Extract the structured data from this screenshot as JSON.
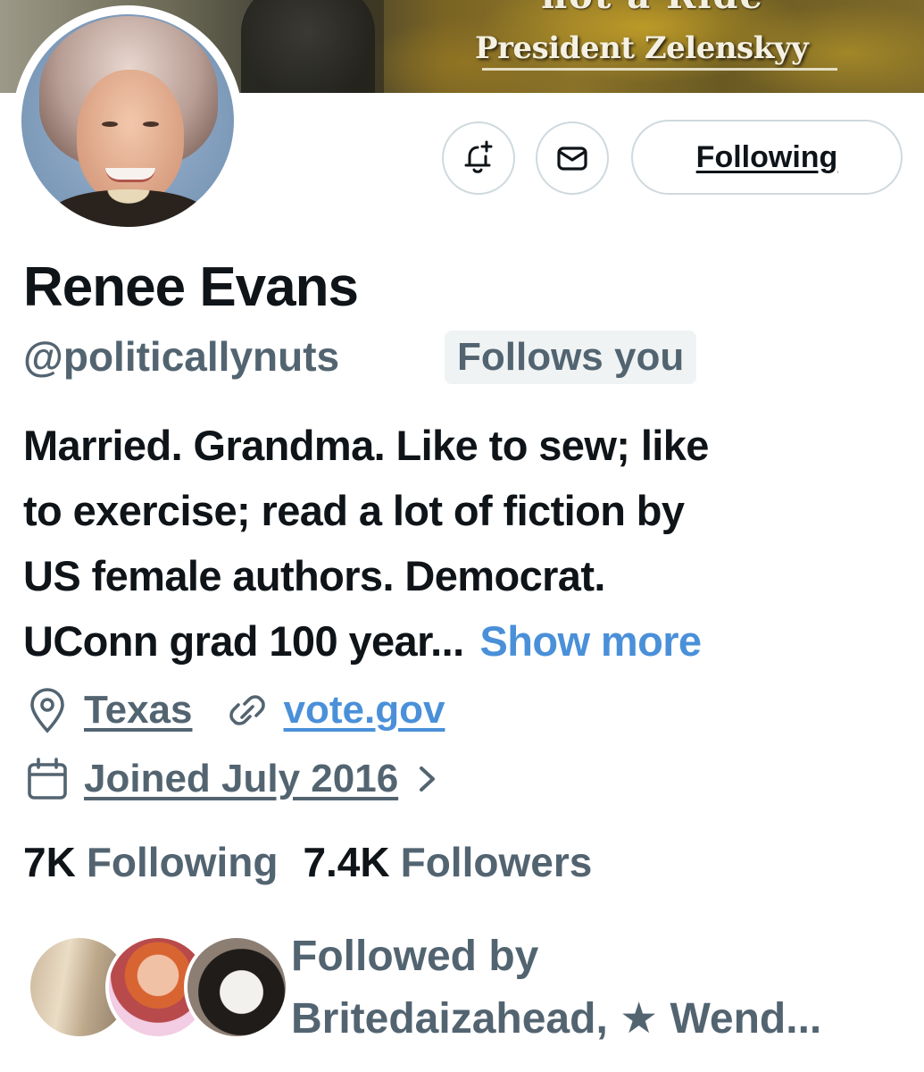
{
  "banner": {
    "headline_top": "not a Ride",
    "headline": "President Zelenskyy"
  },
  "actions": {
    "notify_icon": "bell-plus-icon",
    "message_icon": "envelope-icon",
    "follow_label": "Following"
  },
  "profile": {
    "display_name": "Renee Evans",
    "handle": "@politicallynuts",
    "follows_you": "Follows you",
    "bio_lines": [
      "Married. Grandma. Like to sew; like",
      "to exercise; read a lot of fiction by",
      "US female authors. Democrat.",
      "UConn grad 100 year..."
    ],
    "show_more": "Show more",
    "location": "Texas",
    "website": "vote.gov",
    "joined": "Joined July 2016"
  },
  "counts": {
    "following_num": "7K",
    "following_label": "Following",
    "followers_num": "7.4K",
    "followers_label": "Followers"
  },
  "followed_by": {
    "line1": "Followed by",
    "line2": "Britedaizahead, ★ Wend..."
  },
  "colors": {
    "text_primary": "#0f1419",
    "text_secondary": "#536471",
    "link": "#4a90d9",
    "border": "#cfd9de",
    "badge_bg": "#eff3f4"
  }
}
